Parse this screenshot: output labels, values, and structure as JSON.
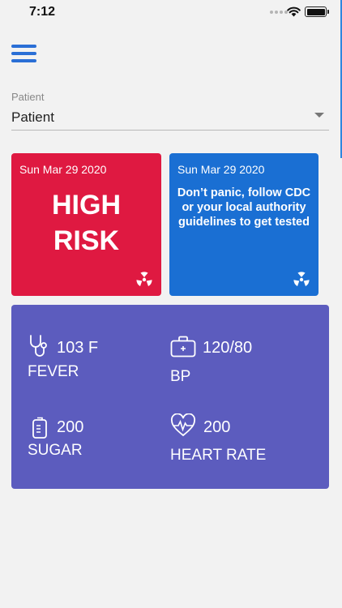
{
  "status_bar": {
    "time": "7:12"
  },
  "patient_field": {
    "label": "Patient",
    "value": "Patient"
  },
  "risk_card": {
    "date": "Sun Mar 29 2020",
    "status_line1": "HIGH",
    "status_line2": "RISK",
    "color": "#df1941",
    "icon": "radiation-icon"
  },
  "advice_card": {
    "date": "Sun Mar 29 2020",
    "message": "Don’t panic, follow CDC or your local authority guidelines to get tested",
    "color": "#1a6fd3",
    "icon": "radiation-icon"
  },
  "vitals": {
    "color": "#5c5cbe",
    "fever": {
      "value": "103 F",
      "label": "FEVER",
      "icon": "stethoscope-icon"
    },
    "bp": {
      "value": "120/80",
      "label": "BP",
      "icon": "medical-kit-icon"
    },
    "sugar": {
      "value": "200",
      "label": "SUGAR",
      "icon": "blood-bag-icon"
    },
    "heart_rate": {
      "value": "200",
      "label": "HEART RATE",
      "icon": "heart-pulse-icon"
    }
  }
}
